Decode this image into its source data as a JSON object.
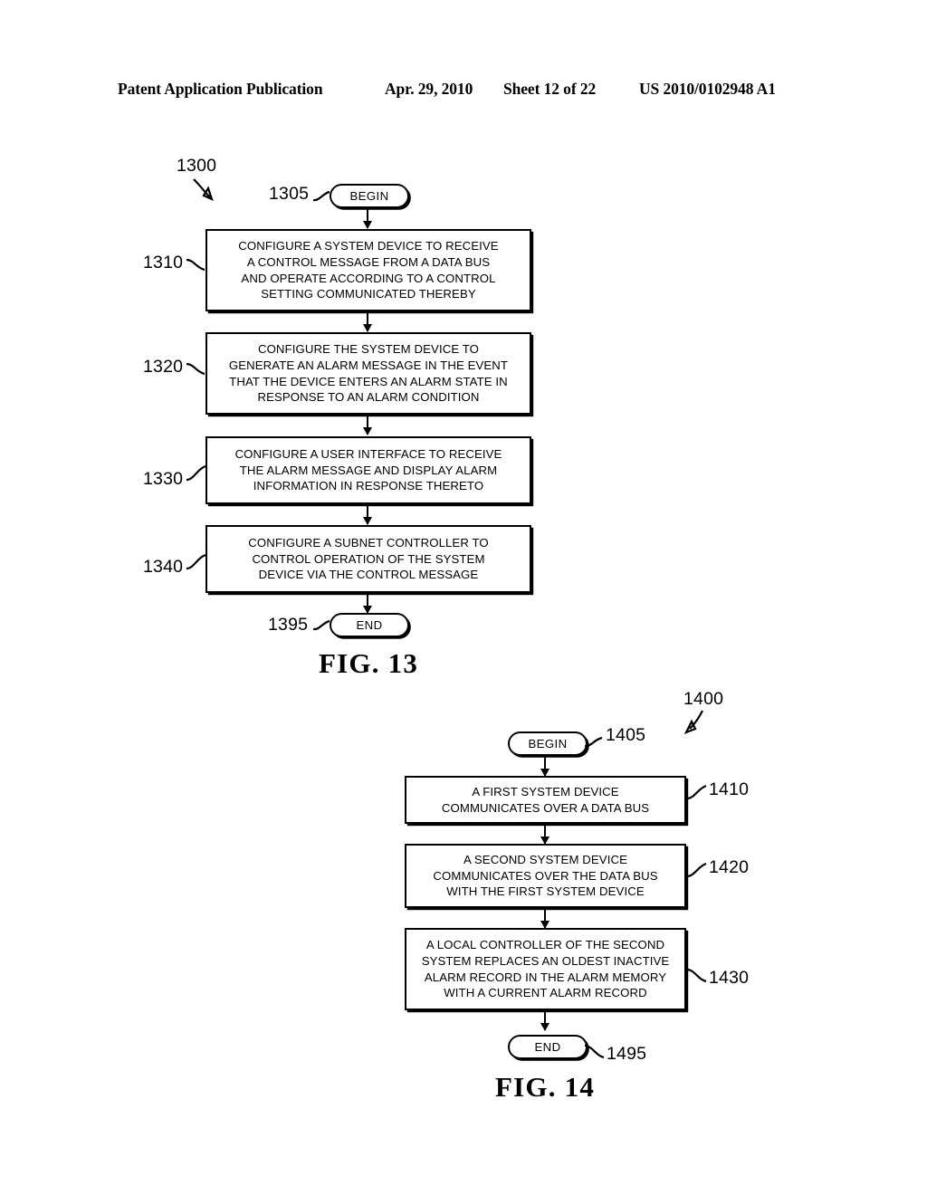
{
  "header": {
    "publication": "Patent Application Publication",
    "date": "Apr. 29, 2010",
    "sheet": "Sheet 12 of 22",
    "patent_number": "US 2010/0102948 A1"
  },
  "figures": [
    {
      "caption": "FIG. 13",
      "figure_ref": "1300",
      "begin": {
        "label": "BEGIN",
        "ref": "1305"
      },
      "end": {
        "label": "END",
        "ref": "1395"
      },
      "steps": [
        {
          "ref": "1310",
          "text": "CONFIGURE A SYSTEM DEVICE TO RECEIVE\nA CONTROL MESSAGE FROM A DATA BUS\nAND OPERATE ACCORDING TO A CONTROL\nSETTING COMMUNICATED THEREBY"
        },
        {
          "ref": "1320",
          "text": "CONFIGURE THE SYSTEM DEVICE TO\nGENERATE AN ALARM MESSAGE IN THE EVENT\nTHAT THE DEVICE ENTERS AN ALARM STATE IN\nRESPONSE TO AN ALARM CONDITION"
        },
        {
          "ref": "1330",
          "text": "CONFIGURE A USER INTERFACE TO RECEIVE\nTHE ALARM MESSAGE AND DISPLAY ALARM\nINFORMATION IN RESPONSE THERETO"
        },
        {
          "ref": "1340",
          "text": "CONFIGURE A SUBNET CONTROLLER TO\nCONTROL OPERATION OF THE SYSTEM\nDEVICE VIA THE CONTROL MESSAGE"
        }
      ]
    },
    {
      "caption": "FIG. 14",
      "figure_ref": "1400",
      "begin": {
        "label": "BEGIN",
        "ref": "1405"
      },
      "end": {
        "label": "END",
        "ref": "1495"
      },
      "steps": [
        {
          "ref": "1410",
          "text": "A FIRST SYSTEM DEVICE\nCOMMUNICATES OVER A DATA BUS"
        },
        {
          "ref": "1420",
          "text": "A SECOND SYSTEM DEVICE\nCOMMUNICATES OVER THE DATA BUS\nWITH THE FIRST SYSTEM DEVICE"
        },
        {
          "ref": "1430",
          "text": "A LOCAL CONTROLLER OF THE SECOND\nSYSTEM REPLACES AN OLDEST INACTIVE\nALARM RECORD IN THE ALARM MEMORY\nWITH A CURRENT ALARM RECORD"
        }
      ]
    }
  ]
}
